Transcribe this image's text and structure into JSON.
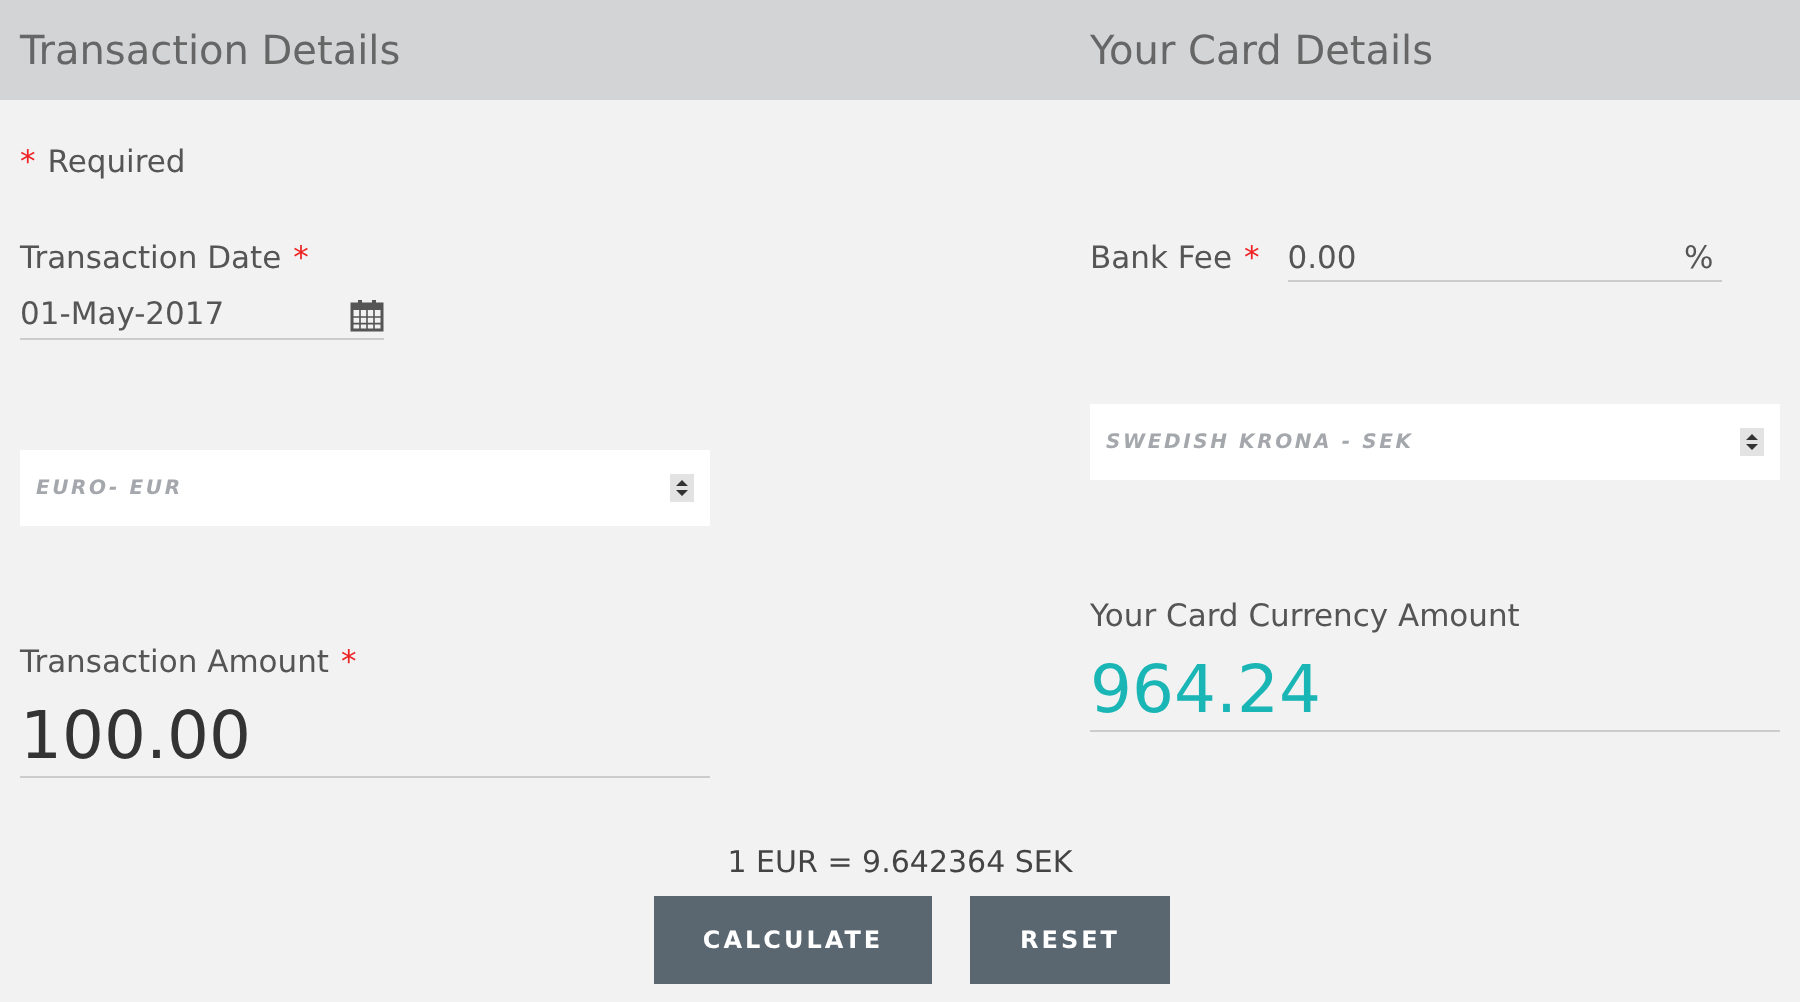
{
  "header": {
    "left_title": "Transaction Details",
    "right_title": "Your Card Details"
  },
  "required_note": {
    "mark": "*",
    "text": "Required"
  },
  "transaction_date": {
    "label": "Transaction Date",
    "mark": "*",
    "value": "01-May-2017"
  },
  "from_currency": {
    "value": "EURO- EUR"
  },
  "transaction_amount": {
    "label": "Transaction Amount",
    "mark": "*",
    "value": "100.00"
  },
  "bank_fee": {
    "label": "Bank Fee",
    "mark": "*",
    "value": "0.00",
    "unit": "%"
  },
  "to_currency": {
    "value": "SWEDISH KRONA - SEK"
  },
  "card_amount": {
    "label": "Your Card Currency Amount",
    "value": "964.24"
  },
  "rate": "1 EUR = 9.642364 SEK",
  "buttons": [
    {
      "label": "CALCULATE"
    },
    {
      "label": "RESET"
    }
  ]
}
